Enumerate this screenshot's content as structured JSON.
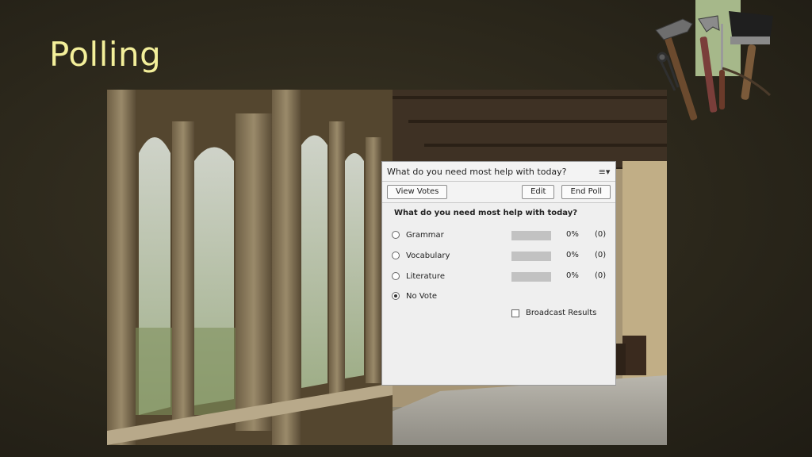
{
  "slide": {
    "title": "Polling"
  },
  "icons": {
    "tools": "tools-icon",
    "menu": "menu-icon"
  },
  "colors": {
    "title": "#f3ef9a",
    "accent_tab": "#a6b88a"
  },
  "poll": {
    "window_title": "What do you need most help with today?",
    "menu_glyph": "≡▾",
    "buttons": {
      "view_votes": "View Votes",
      "edit": "Edit",
      "end_poll": "End Poll"
    },
    "question": "What do you need most help with today?",
    "options": [
      {
        "label": "Grammar",
        "percent": "0%",
        "count": "(0)",
        "share": 0,
        "selected": false
      },
      {
        "label": "Vocabulary",
        "percent": "0%",
        "count": "(0)",
        "share": 0,
        "selected": false
      },
      {
        "label": "Literature",
        "percent": "0%",
        "count": "(0)",
        "share": 0,
        "selected": false
      }
    ],
    "no_vote": {
      "label": "No Vote",
      "selected": true
    },
    "broadcast": {
      "label": "Broadcast Results",
      "checked": false
    }
  }
}
